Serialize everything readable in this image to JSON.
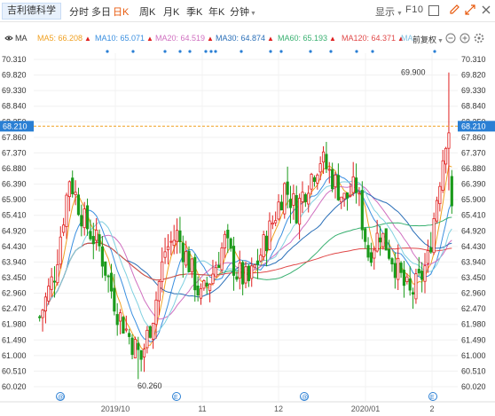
{
  "toolbar": {
    "stock_name": "吉利德科学",
    "tabs": [
      {
        "label": "分时",
        "dropdown": false,
        "active": false
      },
      {
        "label": "多日",
        "dropdown": false,
        "active": false
      },
      {
        "label": "日K",
        "dropdown": false,
        "active": true
      },
      {
        "label": "周K",
        "dropdown": false,
        "active": false
      },
      {
        "label": "月K",
        "dropdown": false,
        "active": false
      },
      {
        "label": "季K",
        "dropdown": false,
        "active": false
      },
      {
        "label": "年K",
        "dropdown": false,
        "active": false
      },
      {
        "label": "分钟",
        "dropdown": true,
        "active": false
      }
    ],
    "display_label": "显示",
    "f10_label": "F10"
  },
  "indicator_bar": {
    "ma_label": "MA",
    "items": [
      {
        "label": "MA5: 66.208",
        "color": "#f0a020"
      },
      {
        "label": "MA10: 65.071",
        "color": "#3a8fe0"
      },
      {
        "label": "MA20: 64.519",
        "color": "#d070c0"
      },
      {
        "label": "MA30: 64.874",
        "color": "#2a6fb8"
      },
      {
        "label": "MA60: 65.193",
        "color": "#38b070"
      },
      {
        "label": "MA120: 64.371",
        "color": "#e04848"
      },
      {
        "label": "MA:",
        "color": "#80c0e0"
      }
    ],
    "adjust_label": "前复权"
  },
  "price_axis": [
    "70.310",
    "69.820",
    "69.330",
    "68.840",
    "68.350",
    "67.860",
    "67.370",
    "66.880",
    "66.390",
    "65.900",
    "65.410",
    "64.920",
    "64.430",
    "63.940",
    "63.450",
    "62.960",
    "62.470",
    "61.980",
    "61.490",
    "61.000",
    "60.510",
    "60.020"
  ],
  "crosshair_price": "68.210",
  "annotations": {
    "high": "69.900",
    "low": "60.260"
  },
  "x_labels": [
    "2019/10",
    "11",
    "12",
    "2020/01",
    "2"
  ],
  "colors": {
    "up": "#e02020",
    "down": "#1a9a1a",
    "crosshair": "#f0a020",
    "accent": "#e8590c"
  },
  "chart_data": {
    "type": "candlestick",
    "y_axis_ticks": [
      "70.310",
      "69.820",
      "69.330",
      "68.840",
      "68.350",
      "67.860",
      "67.370",
      "66.880",
      "66.390",
      "65.900",
      "65.410",
      "64.920",
      "64.430",
      "63.940",
      "63.450",
      "62.960",
      "62.470",
      "61.980",
      "61.490",
      "61.000",
      "60.510",
      "60.020"
    ],
    "ylim": [
      60.02,
      70.31
    ],
    "x_labels": [
      "2019/10",
      "11",
      "12",
      "2020/01",
      "2"
    ],
    "crosshair_price": 68.21,
    "max_label": 69.9,
    "min_label": 60.26,
    "ma_legend": [
      "MA5: 66.208",
      "MA10: 65.071",
      "MA20: 64.519",
      "MA30: 64.874",
      "MA60: 65.193",
      "MA120: 64.371"
    ]
  }
}
